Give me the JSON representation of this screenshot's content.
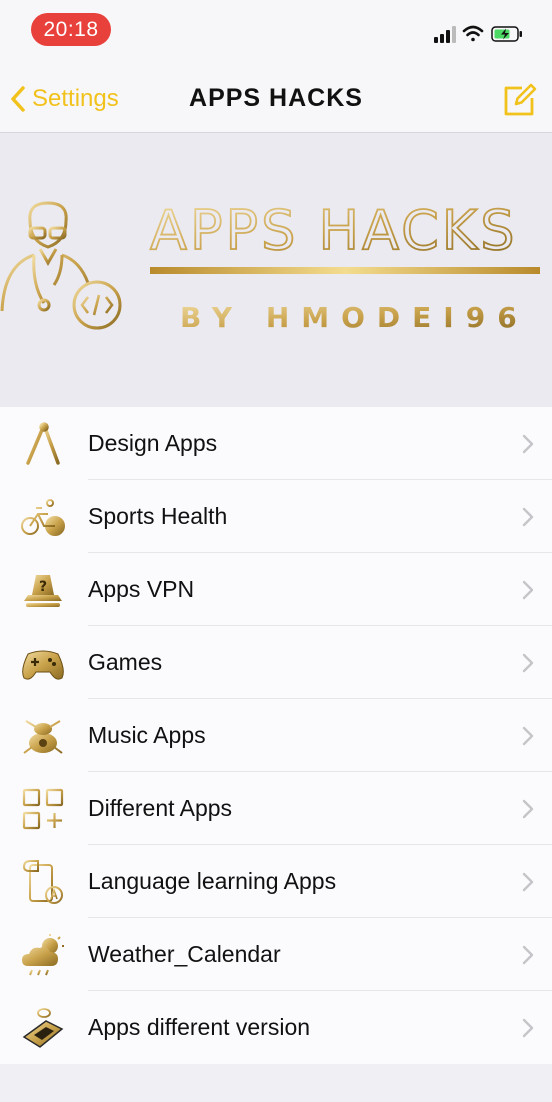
{
  "status_bar": {
    "time": "20:18"
  },
  "nav": {
    "back_label": "Settings",
    "title": "APPS HACKS"
  },
  "banner": {
    "title": "APPS HACKS",
    "subtitle": "BY HMODEI96"
  },
  "colors": {
    "accent": "#f2c21c",
    "gold": "#c9a24b",
    "status_pill": "#e8403b"
  },
  "items": [
    {
      "label": "Design Apps",
      "icon": "design-icon"
    },
    {
      "label": "Sports Health",
      "icon": "bicycle-icon"
    },
    {
      "label": "Apps VPN",
      "icon": "vpn-icon"
    },
    {
      "label": "Games",
      "icon": "gamepad-icon"
    },
    {
      "label": "Music Apps",
      "icon": "music-icon"
    },
    {
      "label": "Different Apps",
      "icon": "apps-grid-icon"
    },
    {
      "label": "Language learning Apps",
      "icon": "language-icon"
    },
    {
      "label": "Weather_Calendar",
      "icon": "weather-icon"
    },
    {
      "label": "Apps different version",
      "icon": "version-icon"
    }
  ]
}
